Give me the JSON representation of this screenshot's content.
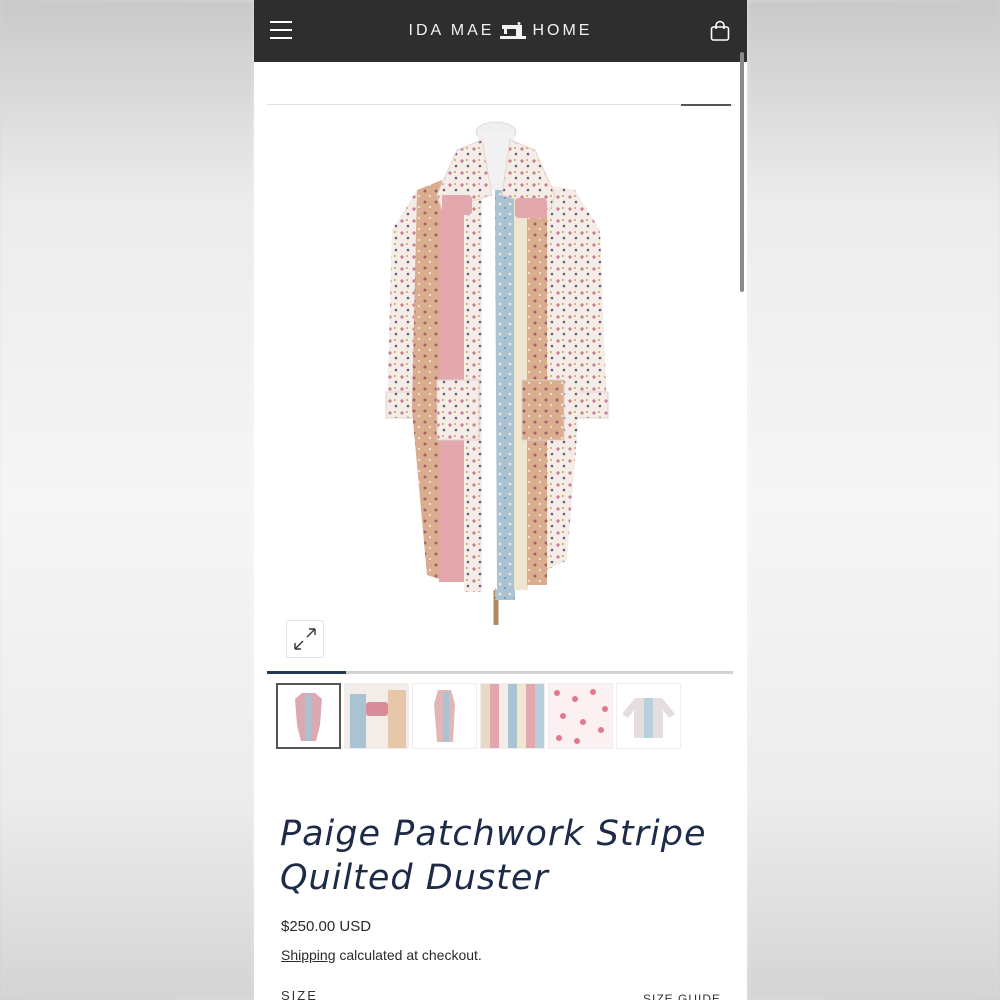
{
  "header": {
    "brand_left": "IDA MAE",
    "brand_right": "HOME",
    "icons": {
      "menu": "hamburger-menu-icon",
      "logo": "sewing-machine-logo-icon",
      "cart": "shopping-bag-icon"
    }
  },
  "gallery": {
    "progress_fraction": 0.17,
    "thumbnails": [
      "duster-front",
      "duster-collar-detail",
      "duster-side",
      "stripe-fabric",
      "floral-fabric",
      "duster-back"
    ],
    "active_index": 0,
    "expand_icon": "expand-arrows-icon"
  },
  "product": {
    "title": "Paige Patchwork Stripe Quilted Duster",
    "price": "$250.00 USD",
    "shipping_link": "Shipping",
    "shipping_text": " calculated at checkout.",
    "size_label": "SIZE",
    "size_guide": "SIZE GUIDE"
  },
  "colors": {
    "header_bg": "#2e2e2e",
    "title_color": "#1d2b47",
    "progress_fill": "#223a57"
  }
}
